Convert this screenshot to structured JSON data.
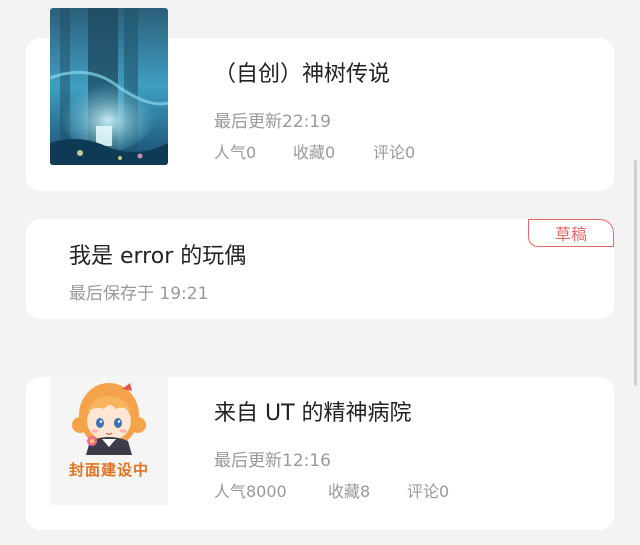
{
  "works": [
    {
      "title": "（自创）神树传说",
      "updated": "最后更新22:19",
      "popularity": "人气0",
      "favorites": "收藏0",
      "comments": "评论0"
    },
    {
      "title": "我是 error 的玩偶",
      "saved": "最后保存于 19:21",
      "badge": "草稿"
    },
    {
      "title": "来自 UT 的精神病院",
      "updated": "最后更新12:16",
      "popularity": "人气8000",
      "favorites": "收藏8",
      "comments": "评论0",
      "cover_label": "封面建设中"
    }
  ],
  "colors": {
    "background": "#f3f3f3",
    "card": "#ffffff",
    "badge": "#e36a66",
    "placeholder_text": "#e2721e"
  }
}
